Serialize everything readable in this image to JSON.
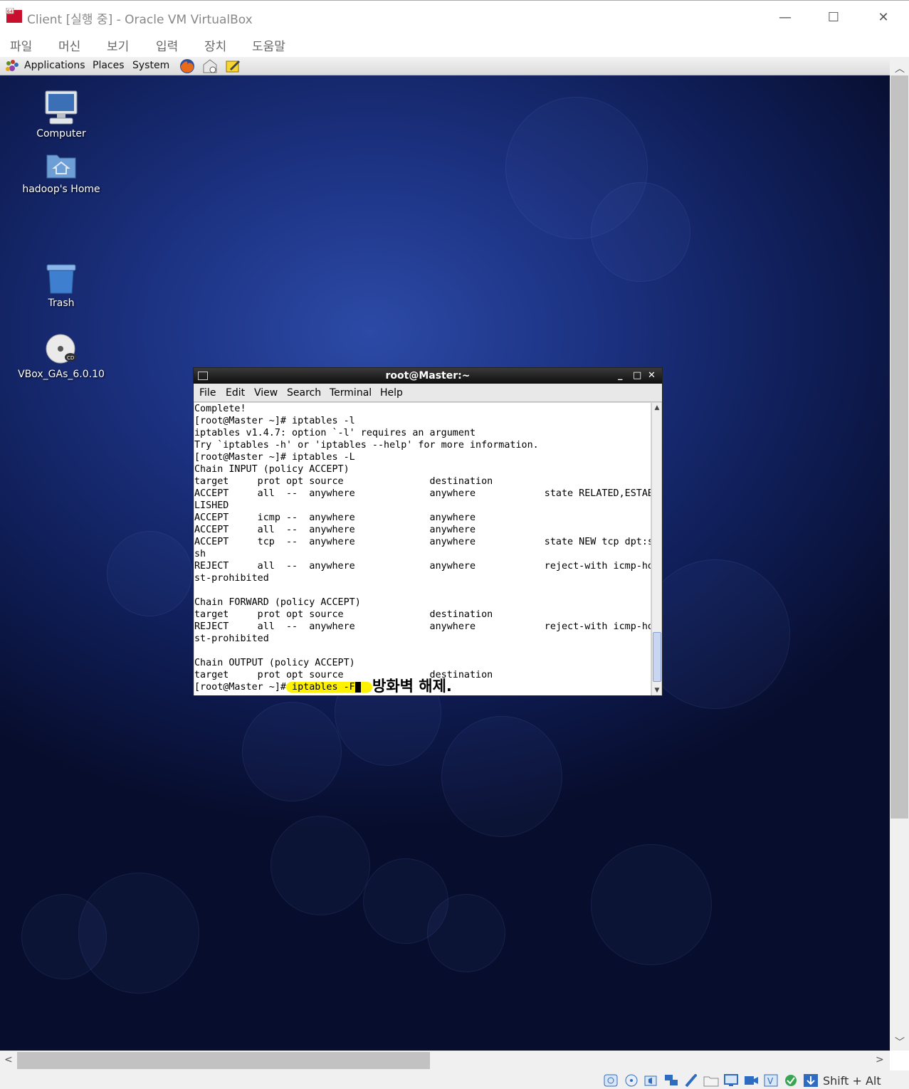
{
  "window": {
    "title": "Client [실행 중] - Oracle VM VirtualBox",
    "minimize_glyph": "—",
    "maximize_glyph": "☐",
    "close_glyph": "✕"
  },
  "host_menu": [
    "파일",
    "머신",
    "보기",
    "입력",
    "장치",
    "도움말"
  ],
  "guest_panel": {
    "menus": [
      "Applications",
      "Places",
      "System"
    ],
    "launchers": [
      "firefox-icon",
      "mail-icon",
      "notes-icon"
    ]
  },
  "desktop_icons": [
    {
      "label": "Computer",
      "icon": "computer-icon"
    },
    {
      "label": "hadoop's Home",
      "icon": "home-folder-icon"
    },
    {
      "label": "Trash",
      "icon": "trash-icon"
    },
    {
      "label": "VBox_GAs_6.0.10",
      "icon": "cd-icon"
    }
  ],
  "terminal": {
    "title": "root@Master:~",
    "controls": [
      "_",
      "□",
      "✕"
    ],
    "menu": [
      "File",
      "Edit",
      "View",
      "Search",
      "Terminal",
      "Help"
    ],
    "lines": [
      "Complete!",
      "[root@Master ~]# iptables -l",
      "iptables v1.4.7: option `-l' requires an argument",
      "Try `iptables -h' or 'iptables --help' for more information.",
      "[root@Master ~]# iptables -L",
      "Chain INPUT (policy ACCEPT)",
      "target     prot opt source               destination",
      "ACCEPT     all  --  anywhere             anywhere            state RELATED,ESTAB",
      "LISHED",
      "ACCEPT     icmp --  anywhere             anywhere",
      "ACCEPT     all  --  anywhere             anywhere",
      "ACCEPT     tcp  --  anywhere             anywhere            state NEW tcp dpt:s",
      "sh",
      "REJECT     all  --  anywhere             anywhere            reject-with icmp-ho",
      "st-prohibited",
      "",
      "Chain FORWARD (policy ACCEPT)",
      "target     prot opt source               destination",
      "REJECT     all  --  anywhere             anywhere            reject-with icmp-ho",
      "st-prohibited",
      "",
      "Chain OUTPUT (policy ACCEPT)",
      "target     prot opt source               destination"
    ],
    "prompt": "[root@Master ~]#",
    "current_command": " iptables -F",
    "annotation": "방화벽 해제."
  },
  "statusbar": {
    "icons": [
      "hard-disk-icon",
      "optical-drive-icon",
      "audio-icon",
      "network-icon",
      "usb-icon",
      "shared-folder-icon",
      "display-icon",
      "recording-icon",
      "vt-x-icon",
      "mouse-integration-icon",
      "keyboard-capture-icon"
    ],
    "host_key": "Shift + Alt"
  },
  "colors": {
    "highlight": "#fff200",
    "desktop_blue": "#1c3282"
  }
}
